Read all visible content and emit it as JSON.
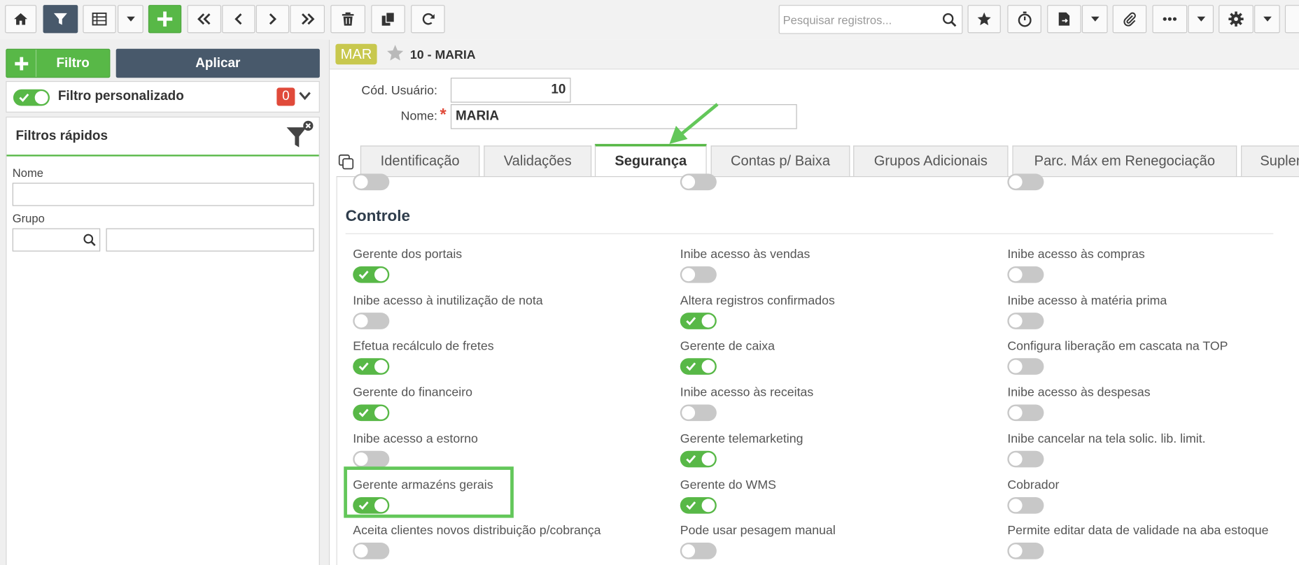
{
  "toolbar": {
    "search_placeholder": "Pesquisar registros...",
    "icons": [
      "home-icon",
      "filter-icon",
      "grid-icon",
      "caret-down-icon",
      "plus-icon",
      "first-icon",
      "prev-icon",
      "next-icon",
      "last-icon",
      "trash-icon",
      "duplicate-icon",
      "refresh-icon",
      "search-icon",
      "star-icon",
      "timer-icon",
      "export-icon",
      "caret-down-icon",
      "paperclip-icon",
      "more-icon",
      "caret-down-icon",
      "gear-icon",
      "caret-down-icon"
    ],
    "colors": {
      "dark": "#48596b",
      "green": "#58b847"
    }
  },
  "left": {
    "filtro_label": "Filtro",
    "aplicar_label": "Aplicar",
    "filtro_personalizado": {
      "label": "Filtro personalizado",
      "enabled": true,
      "count": "0"
    },
    "quick_filters": {
      "title": "Filtros rápidos",
      "nome_label": "Nome",
      "grupo_label": "Grupo"
    }
  },
  "record": {
    "badge": "MAR",
    "title": "10 - MARIA",
    "cod_usuario_label": "Cód. Usuário:",
    "cod_usuario_value": "10",
    "nome_label": "Nome:",
    "nome_value": "MARIA"
  },
  "tabs": [
    {
      "label": "Identificação",
      "active": false
    },
    {
      "label": "Validações",
      "active": false
    },
    {
      "label": "Segurança",
      "active": true
    },
    {
      "label": "Contas p/ Baixa",
      "active": false
    },
    {
      "label": "Grupos Adicionais",
      "active": false
    },
    {
      "label": "Parc. Máx em Renegociação",
      "active": false
    },
    {
      "label": "Suplen",
      "active": false
    }
  ],
  "section": {
    "title": "Controle",
    "items": [
      {
        "label": "Gerente dos portais",
        "on": true
      },
      {
        "label": "Inibe acesso às vendas",
        "on": false
      },
      {
        "label": "Inibe acesso às compras",
        "on": false
      },
      {
        "label": "Inibe acesso à inutilização de nota",
        "on": false
      },
      {
        "label": "Altera registros confirmados",
        "on": true
      },
      {
        "label": "Inibe acesso à matéria prima",
        "on": false
      },
      {
        "label": "Efetua recálculo de fretes",
        "on": true
      },
      {
        "label": "Gerente de caixa",
        "on": true
      },
      {
        "label": "Configura liberação em cascata na TOP",
        "on": false
      },
      {
        "label": "Gerente do financeiro",
        "on": true
      },
      {
        "label": "Inibe acesso às receitas",
        "on": false
      },
      {
        "label": "Inibe acesso às despesas",
        "on": false
      },
      {
        "label": "Inibe acesso a estorno",
        "on": false
      },
      {
        "label": "Gerente telemarketing",
        "on": true
      },
      {
        "label": "Inibe cancelar na tela solic. lib. limit.",
        "on": false
      },
      {
        "label": "Gerente armazéns gerais",
        "on": true
      },
      {
        "label": "Gerente do WMS",
        "on": true
      },
      {
        "label": "Cobrador",
        "on": false
      },
      {
        "label": "Aceita clientes novos distribuição p/cobrança",
        "on": false
      },
      {
        "label": "Pode usar pesagem manual",
        "on": false
      },
      {
        "label": "Permite editar data de validade na aba estoque",
        "on": false
      }
    ]
  }
}
